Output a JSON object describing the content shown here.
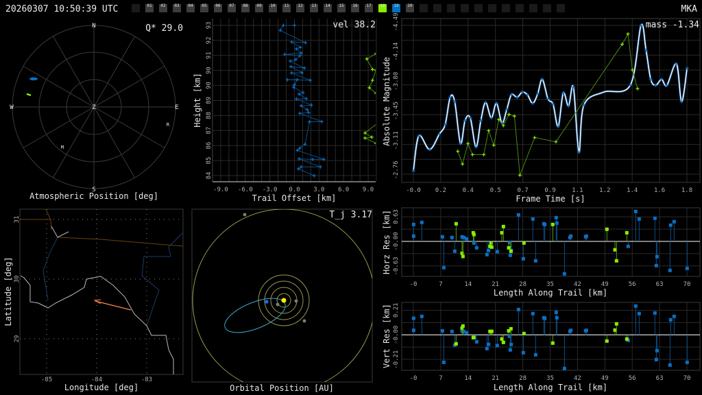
{
  "header": {
    "timestamp": "20260307 10:50:39 UTC",
    "station": "MKA",
    "frames": [
      "",
      "01",
      "02",
      "03",
      "04",
      "05",
      "06",
      "07",
      "08",
      "09",
      "10",
      "11",
      "12",
      "13",
      "14",
      "15",
      "16",
      "17",
      "18",
      "19",
      "20",
      "",
      "",
      "",
      "",
      "",
      "",
      "",
      "",
      "",
      "",
      ""
    ],
    "highlight": {
      "18": "#88ee00",
      "19": "#0070c0"
    }
  },
  "colors": {
    "station_a": "#0a6fc2",
    "station_b": "#88ee00",
    "fit": "#ffffff",
    "arrow": "#ff8844",
    "orbit": "#40a8c8",
    "planet_orbit": "#9a9a50",
    "sun": "#ffee00"
  },
  "sky": {
    "title": "Atmospheric Position [deg]",
    "q_label": "Q* 29.0",
    "compass": {
      "n": "N",
      "e": "E",
      "s": "S",
      "w": "W",
      "z": "Z"
    },
    "markers": {
      "r": "R",
      "m": "M"
    }
  },
  "height_panel": {
    "vel_label": "vel 38.2",
    "xlabel": "Trail Offset [km]",
    "ylabel": "Height [km]",
    "xticks": [
      "-9.0",
      "-6.0",
      "-3.0",
      "0.0",
      "3.0",
      "6.0",
      "9.0"
    ],
    "yticks": [
      "93",
      "92",
      "91",
      "90",
      "90",
      "89",
      "88",
      "87",
      "86",
      "85",
      "84"
    ]
  },
  "mag_panel": {
    "mass_label": "mass -1.34",
    "xlabel": "Frame Time [s]",
    "ylabel": "Absolute Magnitude",
    "xticks": [
      "-0.0",
      "0.2",
      "0.4",
      "0.5",
      "0.7",
      "0.9",
      "1.1",
      "1.2",
      "1.4",
      "1.6",
      "1.8"
    ],
    "yticks": [
      "-4.49",
      "-4.14",
      "-3.80",
      "-3.45",
      "-3.11",
      "-2.76"
    ]
  },
  "horz_panel": {
    "ylabel": "Horz Res [km]",
    "xlabel": "Length Along Trail [km]",
    "yticks": [
      "0.63",
      "-0.00",
      "-0.63"
    ],
    "xticks": [
      "-0",
      "7",
      "14",
      "21",
      "28",
      "35",
      "42",
      "49",
      "56",
      "63",
      "70"
    ]
  },
  "vert_panel": {
    "ylabel": "Vert Res [km]",
    "xlabel": "Length Along Trail [km]",
    "yticks": [
      "0.21",
      "-0.00",
      "-0.21"
    ],
    "xticks": [
      "-0",
      "7",
      "14",
      "21",
      "28",
      "35",
      "42",
      "49",
      "56",
      "63",
      "70"
    ]
  },
  "map_panel": {
    "xlabel": "Longitude [deg]",
    "ylabel": "Latitude [deg]",
    "xticks": [
      "-85",
      "-84",
      "-83"
    ],
    "yticks": [
      "31",
      "30",
      "29"
    ]
  },
  "orbit_panel": {
    "title": "Orbital Position [AU]",
    "tj_label": "T_j 3.17"
  },
  "chart_data": [
    {
      "type": "line",
      "name": "height-vs-offset",
      "xlabel": "Trail Offset [km]",
      "ylabel": "Height [km]",
      "xlim": [
        -10,
        10
      ],
      "ylim": [
        83.6,
        93.4
      ],
      "series": [
        {
          "name": "station-19",
          "x": [
            0.0,
            -1.35,
            -1.74,
            1.35,
            -0.35,
            0.71,
            0.24,
            0.82,
            -1.19,
            0.68,
            0.15,
            -0.52,
            1.21,
            -0.43,
            0.91,
            -0.35,
            1.91,
            -0.85,
            0.32,
            -0.01,
            -0.1,
            1.05,
            0.57,
            1.46,
            0.24,
            2.08,
            0.82,
            1.55,
            1.74,
            0.66,
            3.33,
            1.83,
            1.3,
            0.66,
            0.35,
            3.58,
            2.22,
            0.57,
            3.17,
            0.82,
            0.49,
            2.41
          ],
          "y": [
            93.0,
            93.0,
            92.7,
            91.96,
            92.01,
            91.68,
            91.59,
            91.34,
            91.26,
            91.18,
            90.95,
            90.86,
            90.44,
            90.53,
            90.16,
            90.15,
            89.71,
            89.74,
            89.75,
            89.44,
            89.29,
            88.97,
            88.88,
            88.6,
            88.59,
            88.22,
            88.18,
            87.95,
            87.77,
            87.73,
            87.23,
            87.22,
            85.88,
            85.64,
            85.51,
            84.97,
            84.97,
            85.0,
            84.52,
            84.52,
            84.4,
            83.99
          ]
        },
        {
          "name": "station-18",
          "x": [
            10.3,
            9.95,
            8.83,
            9.53,
            9.95,
            9.53,
            9.14,
            9.95,
            10.3,
            8.61,
            9.44,
            8.61,
            9.95
          ],
          "y": [
            91.4,
            91.3,
            90.99,
            90.36,
            90.32,
            89.71,
            89.26,
            88.93,
            87.2,
            86.55,
            86.3,
            86.25,
            85.93
          ]
        }
      ]
    },
    {
      "type": "line",
      "name": "magnitude-vs-time",
      "xlabel": "Frame Time [s]",
      "ylabel": "Absolute Magnitude",
      "xlim": [
        -0.08,
        1.86
      ],
      "ylim": [
        -4.53,
        -2.64
      ],
      "series": [
        {
          "name": "station-19",
          "x": [
            0.0,
            0.036,
            0.107,
            0.171,
            0.209,
            0.242,
            0.272,
            0.31,
            0.34,
            0.374,
            0.412,
            0.444,
            0.475,
            0.513,
            0.547,
            0.583,
            0.615,
            0.645,
            0.683,
            0.716,
            0.75,
            0.785,
            0.818,
            0.848,
            0.886,
            0.919,
            0.953,
            0.986,
            1.021,
            1.053,
            1.089,
            1.122,
            1.427,
            1.498,
            1.531,
            1.562,
            1.595,
            1.633,
            1.668,
            1.731,
            1.765,
            1.801
          ],
          "y": [
            -2.75,
            -3.16,
            -3.0,
            -3.18,
            -3.29,
            -3.61,
            -3.56,
            -3.07,
            -3.34,
            -3.37,
            -3.03,
            -3.34,
            -3.55,
            -3.37,
            -3.54,
            -3.31,
            -3.47,
            -3.64,
            -3.61,
            -3.67,
            -3.64,
            -3.54,
            -3.65,
            -3.82,
            -3.59,
            -3.53,
            -3.27,
            -3.66,
            -3.51,
            -3.73,
            -2.97,
            -3.52,
            -3.75,
            -4.45,
            -4.16,
            -3.82,
            -3.75,
            -3.82,
            -3.75,
            -4.0,
            -3.56,
            -3.95
          ]
        },
        {
          "name": "station-18",
          "x": [
            0.292,
            0.323,
            0.359,
            0.389,
            0.463,
            0.495,
            0.529,
            0.562,
            0.592,
            0.629,
            0.665,
            0.701,
            0.798,
            0.938,
            1.374,
            1.412,
            1.441,
            1.475
          ],
          "y": [
            -2.98,
            -2.83,
            -3.07,
            -2.94,
            -2.94,
            -3.22,
            -3.05,
            -3.35,
            -3.28,
            -3.41,
            -3.39,
            -2.7,
            -3.14,
            -3.09,
            -4.23,
            -4.35,
            -3.93,
            -3.71
          ]
        }
      ]
    },
    {
      "type": "scatter",
      "name": "residuals",
      "xlabel": "Length Along Trail [km]",
      "xlim": [
        -3,
        73
      ],
      "series": [
        {
          "name": "station-19",
          "L": [
            0.06,
            0.06,
            2.16,
            7.43,
            7.78,
            9.88,
            10.59,
            12.46,
            12.92,
            13.63,
            15.5,
            16.2,
            18.83,
            19.24,
            21.46,
            24.62,
            24.8,
            25.03,
            26.9,
            28.13,
            30.58,
            31.29,
            33.39,
            33.63,
            36.55,
            36.73,
            38.66,
            40.06,
            40.29,
            44.09,
            44.27,
            54.97,
            56.9,
            57.78,
            61.81,
            62.17,
            62.34,
            65.85,
            65.67,
            66.73,
            70.06
          ],
          "horz": [
            0.435,
            0.135,
            0.488,
            0.118,
            -0.676,
            0.1,
            -0.253,
            0.118,
            0.1,
            0.065,
            -0.041,
            -0.165,
            -0.341,
            -0.235,
            -0.265,
            -0.024,
            -0.359,
            -0.235,
            0.682,
            -0.447,
            0.576,
            -0.5,
            0.453,
            0.435,
            0.611,
            0.47,
            -0.835,
            0.1,
            0.135,
            0.118,
            0.135,
            -0.129,
            0.77,
            0.576,
            0.594,
            -0.623,
            -0.394,
            0.417,
            -0.747,
            0.506,
            -0.694
          ],
          "vert": [
            0.139,
            0.038,
            0.155,
            0.034,
            -0.23,
            0.029,
            -0.086,
            0.034,
            0.029,
            0.017,
            -0.017,
            -0.058,
            -0.115,
            -0.08,
            -0.09,
            -0.012,
            -0.126,
            -0.08,
            0.212,
            -0.149,
            0.178,
            -0.167,
            0.143,
            0.138,
            0.189,
            0.143,
            -0.281,
            0.029,
            0.038,
            0.034,
            0.038,
            -0.046,
            0.241,
            0.178,
            0.183,
            -0.207,
            -0.132,
            0.126,
            -0.253,
            0.155,
            -0.23
          ]
        },
        {
          "name": "station-18",
          "L": [
            10.94,
            12.46,
            12.69,
            15.32,
            15.5,
            19.59,
            19.88,
            20.06,
            22.63,
            23.04,
            24.39,
            24.97,
            28.3,
            35.67,
            49.53,
            51.58,
            51.99,
            54.62
          ],
          "horz": [
            0.453,
            -0.306,
            -0.388,
            0.223,
            0.176,
            -0.129,
            -0.041,
            -0.147,
            0.223,
            0.382,
            -0.165,
            -0.253,
            -0.041,
            0.435,
            0.312,
            -0.217,
            -0.5,
            0.223
          ],
          "vert": [
            -0.075,
            0.057,
            0.074,
            -0.023,
            -0.023,
            0.029,
            0.029,
            0.029,
            -0.035,
            -0.063,
            0.034,
            0.051,
            0.011,
            -0.069,
            -0.052,
            0.04,
            0.092,
            -0.035
          ]
        }
      ]
    }
  ]
}
